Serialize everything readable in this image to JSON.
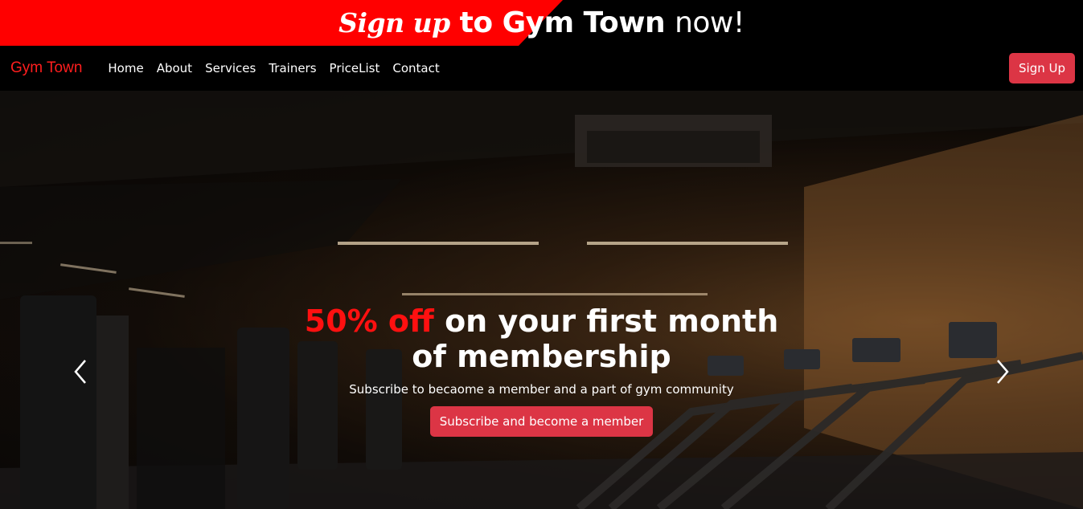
{
  "promo": {
    "part1": "Sign up",
    "part2": "to",
    "part3": "Gym Town",
    "part4": "now!"
  },
  "nav": {
    "brand": "Gym Town",
    "links": [
      "Home",
      "About",
      "Services",
      "Trainers",
      "PriceList",
      "Contact"
    ],
    "signup_label": "Sign Up"
  },
  "hero": {
    "headline_accent": "50% off",
    "headline_rest": "on your first month of membership",
    "subtitle": "Subscribe to becaome a member and a part of gym community",
    "cta_label": "Subscribe and become a member",
    "prev_icon": "chevron-left-icon",
    "next_icon": "chevron-right-icon"
  },
  "colors": {
    "accent_red": "#ff0000",
    "button_red": "#dc3545",
    "navbar_bg": "#000000"
  }
}
